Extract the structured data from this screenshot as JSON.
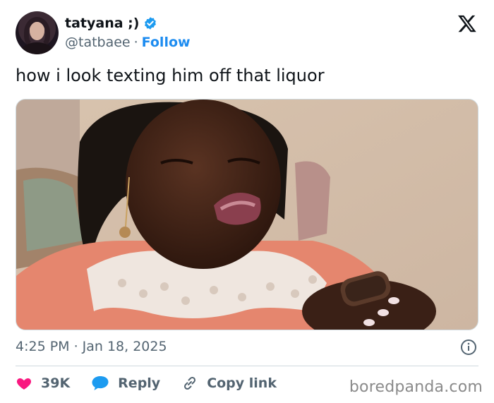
{
  "author": {
    "display_name": "tatyana ;)",
    "handle": "@tatbaee",
    "separator": "·",
    "follow_label": "Follow",
    "verified_icon": "verified-badge-icon",
    "verified_color": "#1d9bf0"
  },
  "platform_logo": "x-logo-icon",
  "tweet": {
    "text": "how i look texting him off that liquor",
    "timestamp_time": "4:25 PM",
    "timestamp_sep": "·",
    "timestamp_date": "Jan 18, 2025"
  },
  "actions": {
    "like_count": "39K",
    "like_icon": "heart-icon",
    "like_color": "#f91880",
    "reply_label": "Reply",
    "reply_icon": "speech-bubble-icon",
    "reply_color": "#1d9bf0",
    "copy_label": "Copy link",
    "copy_icon": "link-icon"
  },
  "watermark": "boredpanda.com",
  "colors": {
    "text_primary": "#0f1419",
    "text_secondary": "#536471",
    "accent": "#1d8cf0",
    "border": "#cfd9de"
  }
}
